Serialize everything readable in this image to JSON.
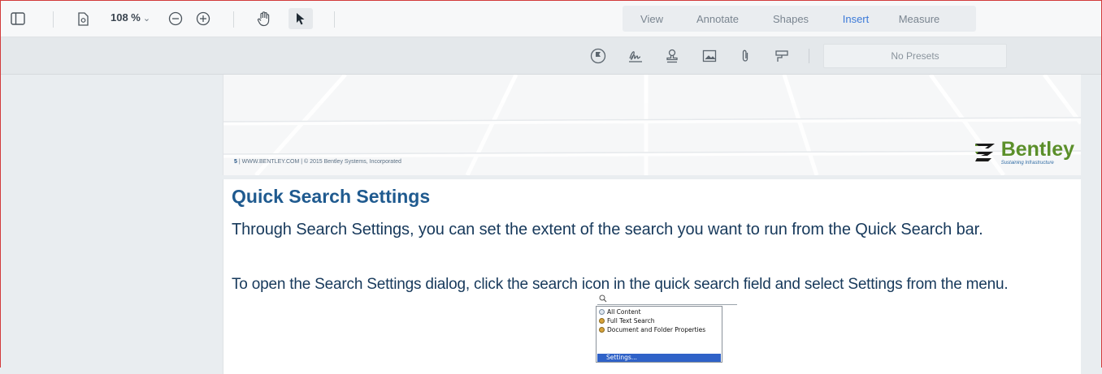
{
  "toolbar": {
    "zoom_value": "108 %",
    "zoom_chevron": "⌄",
    "icons": [
      "sidebar-toggle-icon",
      "page-settings-icon",
      "zoom-out-icon",
      "zoom-in-icon",
      "pan-hand-icon",
      "select-cursor-icon"
    ],
    "tabs": [
      {
        "label": "View",
        "active": false
      },
      {
        "label": "Annotate",
        "active": false
      },
      {
        "label": "Shapes",
        "active": false
      },
      {
        "label": "Insert",
        "active": true
      },
      {
        "label": "Measure",
        "active": false
      }
    ],
    "active_tab_color": "#3c7ad8"
  },
  "subbar": {
    "icons": [
      "stamp-flag-icon",
      "signature-icon",
      "stamp-icon",
      "image-icon",
      "attachment-icon",
      "callout-icon"
    ],
    "presets_label": "No Presets"
  },
  "page_footer": {
    "page_number": "5",
    "text": "| WWW.BENTLEY.COM | © 2015 Bentley Systems, Incorporated",
    "logo_text": "Bentley",
    "logo_tagline": "Sustaining Infrastructure",
    "logo_color": "#5b8f2a"
  },
  "slide": {
    "title": "Quick Search Settings",
    "paragraph1": "Through Search Settings, you can set the extent of the search you want to run from the Quick Search bar.",
    "paragraph2": "To open the Search Settings dialog, click the search icon in the quick search field and select Settings from the menu.",
    "menu": {
      "items": [
        "All Content",
        "Full Text Search",
        "Document and Folder Properties"
      ],
      "selected": "Settings..."
    },
    "title_color": "#1f5a8f"
  }
}
